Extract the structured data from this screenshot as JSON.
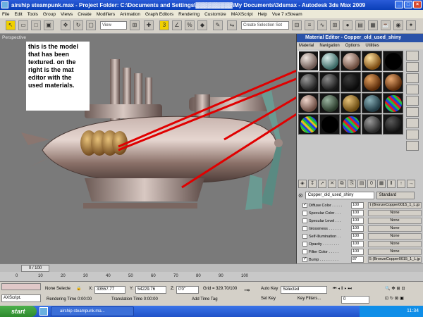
{
  "window": {
    "title": "airship steampunk.max   - Project Folder: C:\\Documents and Settings\\▓▓▓▓▓▓▓▓▓\\My Documents\\3dsmax    - Autodesk 3ds Max  2009",
    "minimize": "_",
    "maximize": "□",
    "close": "×"
  },
  "menubar": [
    "File",
    "Edit",
    "Tools",
    "Group",
    "Views",
    "Create",
    "Modifiers",
    "Animation",
    "Graph Editors",
    "Rendering",
    "Customize",
    "MAXScript",
    "Help",
    "Vue 7 xStream"
  ],
  "toolbar": {
    "view_combo": "View",
    "selection_set": "Create Selection Set"
  },
  "viewport": {
    "label": "Perspective",
    "annotation": "this is the model that has been textured. on the right is the mat editor with the used materials."
  },
  "material_editor": {
    "title": "Material Editor - Copper_old_used_shiny",
    "menu": [
      "Material",
      "Navigation",
      "Options",
      "Utilities"
    ],
    "material_name": "Copper_old_used_shiny",
    "material_type": "Standard",
    "maps": [
      {
        "label": "Diffuse Color . . . . .",
        "checked": true,
        "amount": "100",
        "map": "t (BronzeCopper0015_1_L.jp"
      },
      {
        "label": "Specular Color . . .",
        "checked": false,
        "amount": "100",
        "map": "None"
      },
      {
        "label": "Specular Level . . .",
        "checked": false,
        "amount": "100",
        "map": "None"
      },
      {
        "label": "Glossiness . . . . . .",
        "checked": false,
        "amount": "100",
        "map": "None"
      },
      {
        "label": "Self-Illumination . .",
        "checked": false,
        "amount": "100",
        "map": "None"
      },
      {
        "label": "Opacity . . . . . . . .",
        "checked": false,
        "amount": "100",
        "map": "None"
      },
      {
        "label": "Filter Color . . . . .",
        "checked": false,
        "amount": "100",
        "map": "None"
      },
      {
        "label": "Bump . . . . . . . . .",
        "checked": true,
        "amount": "87",
        "map": "5 (BronzeCopper0015_1_L.jp"
      },
      {
        "label": "Reflection . . . . . .",
        "checked": false,
        "amount": "100",
        "map": "None"
      },
      {
        "label": "Refraction . . . . . .",
        "checked": false,
        "amount": "100",
        "map": "None"
      },
      {
        "label": "Displacement . . . .",
        "checked": false,
        "amount": "100",
        "map": "None"
      }
    ]
  },
  "timeline": {
    "frame": "0 / 100",
    "ticks": [
      "0",
      "10",
      "20",
      "30",
      "40",
      "50",
      "60",
      "70",
      "80",
      "90",
      "100"
    ]
  },
  "status": {
    "selection": "None Selecte",
    "x_value": "33557.77",
    "y_value": "54229.76",
    "z_value": "0'0\"",
    "grid": "Grid = 329.70/100",
    "auto_key": "Auto Key",
    "key_mode": "Selected",
    "set_key": "Set Key",
    "key_filters": "Key Filters...",
    "frame_value": "0",
    "rendering_time": "Rendering Time  0:00:00",
    "translation_time": "Translation Time  0:00:00",
    "add_time_tag": "Add Time Tag",
    "maxscript": "AXScript."
  },
  "taskbar": {
    "start": "start",
    "item": "airship steampunk.ma...",
    "lang": "EN",
    "clock": "11:34"
  },
  "colors": {
    "title_blue": "#0a3fb8",
    "annotation_line": "#e00000",
    "taskbar_blue": "#1f52c8"
  }
}
